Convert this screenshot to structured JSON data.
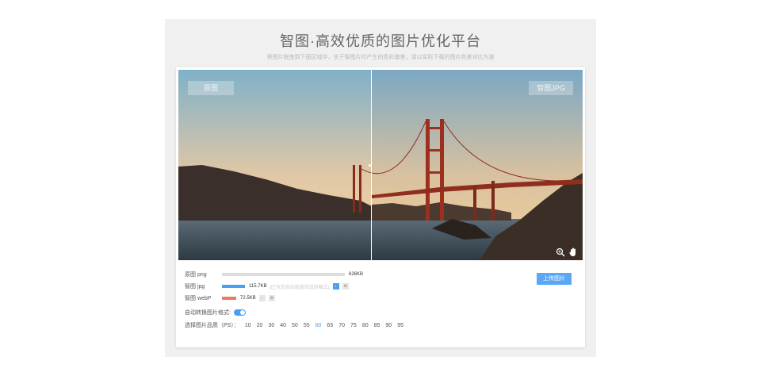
{
  "header": {
    "title": "智图·高效优质的图片优化平台",
    "subtitle": "将图片拖曳到下面区域中，关于智图片时产生的色彩偏差，请以实际下载的图片色差对比为准"
  },
  "viewer": {
    "left_tag": "原图",
    "right_tag": "智图JPG",
    "handle_glyph": "◂▸",
    "zoom_icon": "zoom-in-icon",
    "hand_icon": "hand-icon"
  },
  "stats": {
    "rows": [
      {
        "label": "原图 png",
        "size": "626KB",
        "fraction": 1.0,
        "color": "#dcdcdc"
      },
      {
        "label": "智图 jpg",
        "size": "115.7KB",
        "fraction": 0.185,
        "color": "#4a9ff0",
        "note": "(已为您自动选择合适的格式)"
      },
      {
        "label": "智图 webP",
        "size": "72.5KB",
        "fraction": 0.116,
        "color": "#f07a60"
      }
    ],
    "mini_buttons": [
      "↓",
      "⊗"
    ]
  },
  "upload_button": "上传图片",
  "auto_convert": {
    "label": "自动转换图片格式:",
    "enabled": true
  },
  "quality": {
    "label": "选择图片品质（PS）：",
    "options": [
      "10",
      "20",
      "30",
      "40",
      "50",
      "55",
      "60",
      "65",
      "70",
      "75",
      "80",
      "85",
      "90",
      "95"
    ],
    "selected": "60"
  },
  "colors": {
    "accent": "#4a9ff0",
    "webp": "#f07a60"
  }
}
